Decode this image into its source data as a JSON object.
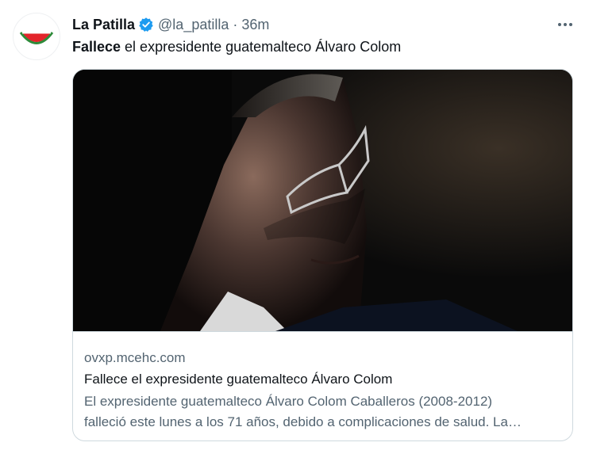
{
  "tweet": {
    "display_name": "La Patilla",
    "handle": "@la_patilla",
    "separator": "·",
    "time": "36m",
    "more_label": "···",
    "text_bold": "Fallece",
    "text_rest": " el expresidente guatemalteco Álvaro Colom"
  },
  "card": {
    "domain": "ovxp.mcehc.com",
    "title": "Fallece el expresidente guatemalteco Álvaro Colom",
    "description_line1": "  El expresidente guatemalteco Álvaro Colom Caballeros (2008-2012)",
    "description_line2": "falleció este lunes a los 71 años, debido a complicaciones de salud. La…",
    "image_icon": "portrait-photo"
  },
  "icons": {
    "avatar": "watermelon-logo-icon",
    "verified": "verified-badge-icon",
    "more": "more-options-icon"
  },
  "colors": {
    "verified": "#1d9bf0",
    "secondary_text": "#536471",
    "primary_text": "#0f1419",
    "border": "#cfd9de"
  }
}
